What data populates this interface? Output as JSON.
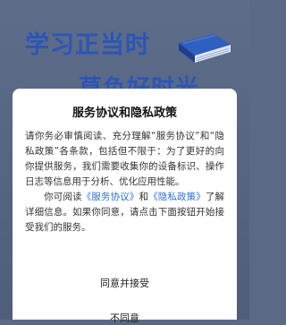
{
  "background": {
    "slogan_line1": "学习正当时",
    "slogan_line2": "莫负好时光"
  },
  "dialog": {
    "title": "服务协议和隐私政策",
    "paragraph1": "请你务必审慎阅读、充分理解“服务协议”和“隐私政策”各条款，包括但不限于：为了更好的向你提供服务，我们需要收集你的设备标识、操作日志等信息用于分析、优化应用性能。",
    "paragraph2_prefix": "你可阅读",
    "service_link": "《服务协议》",
    "and_text": "和",
    "privacy_link": "《隐私政策》",
    "paragraph2_suffix": "了解详细信息。如果你同意，请点击下面按钮开始接受我们的服务。",
    "agree_label": "同意并接受",
    "disagree_label": "不同意"
  },
  "colors": {
    "link": "#2f6fd6",
    "slogan": "#2b55b8"
  }
}
